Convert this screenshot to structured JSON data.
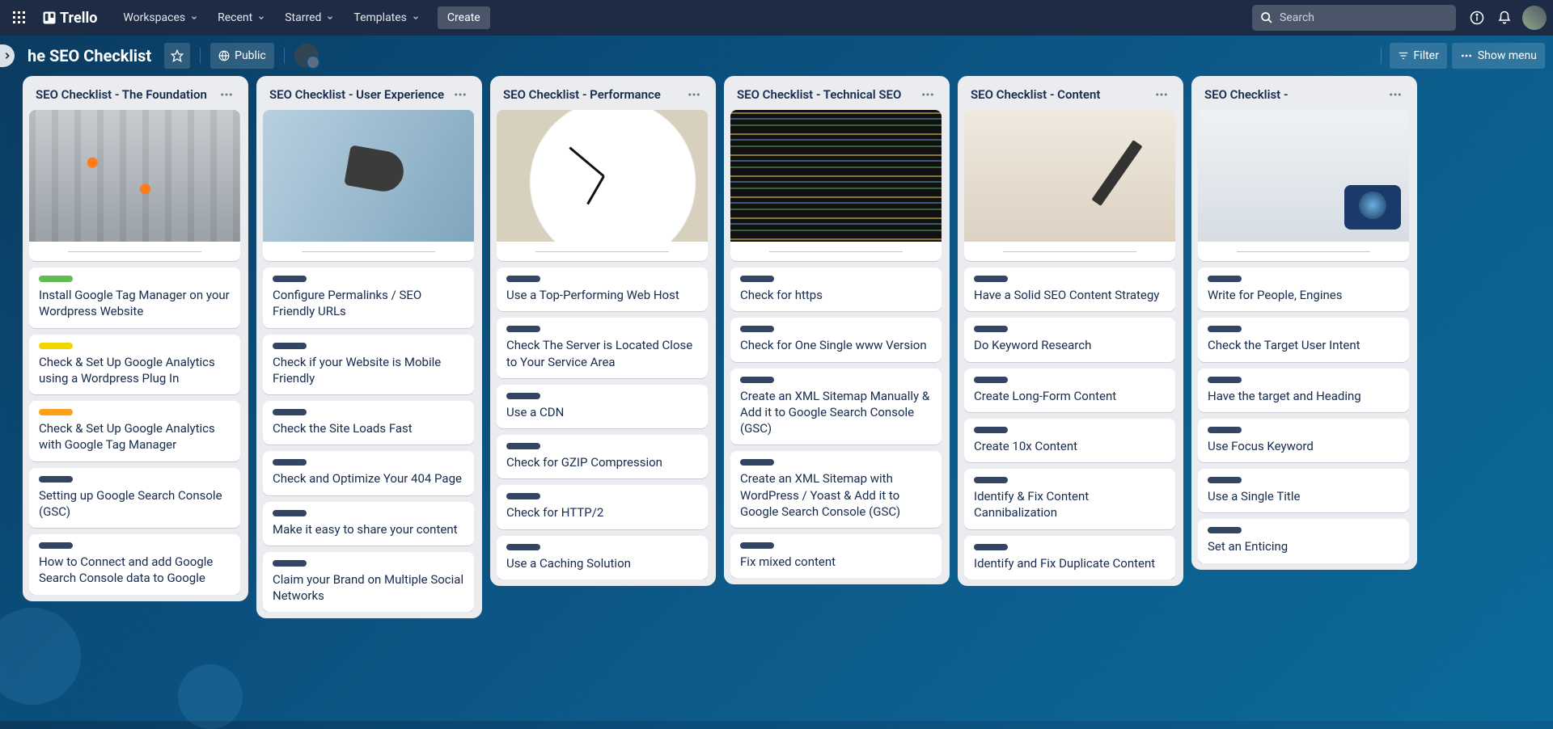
{
  "nav": {
    "logo": "Trello",
    "items": [
      "Workspaces",
      "Recent",
      "Starred",
      "Templates"
    ],
    "create": "Create",
    "search_placeholder": "Search"
  },
  "boardbar": {
    "title": "he SEO Checklist",
    "visibility": "Public",
    "filter": "Filter",
    "menu": "Show menu"
  },
  "lists": [
    {
      "title": "SEO Checklist - The Foundation",
      "coverClass": "cov-construction",
      "cards": [
        {
          "label": "green",
          "title": "Install Google Tag Manager on your Wordpress Website"
        },
        {
          "label": "yellow",
          "title": "Check & Set Up Google Analytics using a Wordpress Plug In"
        },
        {
          "label": "orange",
          "title": "Check & Set Up Google Analytics with Google Tag Manager"
        },
        {
          "label": "darkblue",
          "title": "Setting up Google Search Console (GSC)"
        },
        {
          "label": "darkblue",
          "title": "How to Connect and add Google Search Console data to Google"
        }
      ]
    },
    {
      "title": "SEO Checklist - User Experience",
      "coverClass": "cov-ux",
      "cards": [
        {
          "label": "darkblue",
          "title": "Configure Permalinks / SEO Friendly URLs"
        },
        {
          "label": "darkblue",
          "title": "Check if your Website is Mobile Friendly"
        },
        {
          "label": "darkblue",
          "title": "Check the Site Loads Fast"
        },
        {
          "label": "darkblue",
          "title": "Check and Optimize Your 404 Page"
        },
        {
          "label": "darkblue",
          "title": "Make it easy to share your content"
        },
        {
          "label": "darkblue",
          "title": "Claim your Brand on Multiple Social Networks"
        }
      ]
    },
    {
      "title": "SEO Checklist - Performance",
      "coverClass": "cov-clock",
      "cards": [
        {
          "label": "darkblue",
          "title": "Use a Top-Performing Web Host"
        },
        {
          "label": "darkblue",
          "title": "Check The Server is Located Close to Your Service Area"
        },
        {
          "label": "darkblue",
          "title": "Use a CDN"
        },
        {
          "label": "darkblue",
          "title": "Check for GZIP Compression"
        },
        {
          "label": "darkblue",
          "title": "Check for HTTP/2"
        },
        {
          "label": "darkblue",
          "title": "Use a Caching Solution"
        }
      ]
    },
    {
      "title": "SEO Checklist - Technical SEO",
      "coverClass": "cov-code",
      "cards": [
        {
          "label": "darkblue",
          "title": "Check for https"
        },
        {
          "label": "darkblue",
          "title": "Check for One Single www Version"
        },
        {
          "label": "darkblue",
          "title": "Create an XML Sitemap Manually & Add it to Google Search Console (GSC)"
        },
        {
          "label": "darkblue",
          "title": "Create an XML Sitemap with WordPress / Yoast & Add it to Google Search Console (GSC)"
        },
        {
          "label": "darkblue",
          "title": "Fix mixed content"
        }
      ]
    },
    {
      "title": "SEO Checklist - Content",
      "coverClass": "cov-content",
      "cards": [
        {
          "label": "darkblue",
          "title": "Have a Solid SEO Content Strategy"
        },
        {
          "label": "darkblue",
          "title": "Do Keyword Research"
        },
        {
          "label": "darkblue",
          "title": "Create Long-Form Content"
        },
        {
          "label": "darkblue",
          "title": "Create 10x Content"
        },
        {
          "label": "darkblue",
          "title": "Identify & Fix Content Cannibalization"
        },
        {
          "label": "darkblue",
          "title": "Identify and Fix Duplicate Content"
        }
      ]
    },
    {
      "title": "SEO Checklist -",
      "coverClass": "cov-camera",
      "cards": [
        {
          "label": "darkblue",
          "title": "Write for People, Engines"
        },
        {
          "label": "darkblue",
          "title": "Check the Target User Intent"
        },
        {
          "label": "darkblue",
          "title": "Have the target and Heading"
        },
        {
          "label": "darkblue",
          "title": "Use Focus Keyword"
        },
        {
          "label": "darkblue",
          "title": "Use a Single Title"
        },
        {
          "label": "darkblue",
          "title": "Set an Enticing"
        }
      ]
    }
  ]
}
